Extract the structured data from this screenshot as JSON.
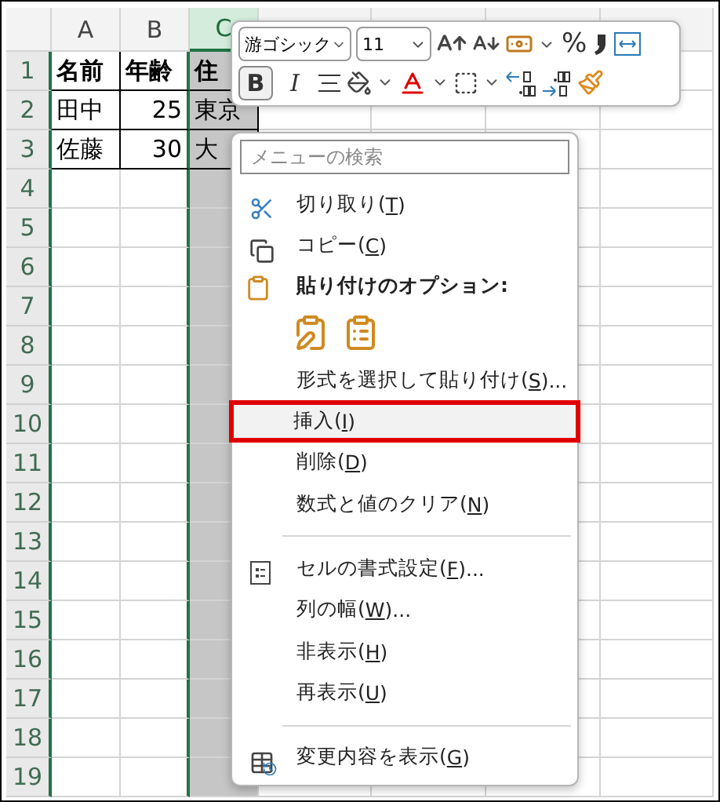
{
  "sheet": {
    "columns": [
      {
        "label": "A",
        "selected": false
      },
      {
        "label": "B",
        "selected": false
      },
      {
        "label": "C",
        "selected": true
      }
    ],
    "rows": [
      {
        "number": "1",
        "bold": true,
        "cells": [
          {
            "text": "名前",
            "numeric": false
          },
          {
            "text": "年齢",
            "numeric": false
          },
          {
            "text": "住",
            "numeric": false
          }
        ]
      },
      {
        "number": "2",
        "bold": false,
        "cells": [
          {
            "text": "田中",
            "numeric": false
          },
          {
            "text": "25",
            "numeric": true
          },
          {
            "text": "東京",
            "numeric": false
          }
        ]
      },
      {
        "number": "3",
        "bold": false,
        "cells": [
          {
            "text": "佐藤",
            "numeric": false
          },
          {
            "text": "30",
            "numeric": true
          },
          {
            "text": "大",
            "numeric": false
          }
        ]
      },
      {
        "number": "4",
        "bold": false,
        "cells": []
      },
      {
        "number": "5",
        "bold": false,
        "cells": []
      },
      {
        "number": "6",
        "bold": false,
        "cells": []
      },
      {
        "number": "7",
        "bold": false,
        "cells": []
      },
      {
        "number": "8",
        "bold": false,
        "cells": []
      },
      {
        "number": "9",
        "bold": false,
        "cells": []
      },
      {
        "number": "10",
        "bold": false,
        "cells": []
      },
      {
        "number": "11",
        "bold": false,
        "cells": []
      },
      {
        "number": "12",
        "bold": false,
        "cells": []
      },
      {
        "number": "13",
        "bold": false,
        "cells": []
      },
      {
        "number": "14",
        "bold": false,
        "cells": []
      },
      {
        "number": "15",
        "bold": false,
        "cells": []
      },
      {
        "number": "16",
        "bold": false,
        "cells": []
      },
      {
        "number": "17",
        "bold": false,
        "cells": []
      },
      {
        "number": "18",
        "bold": false,
        "cells": []
      },
      {
        "number": "19",
        "bold": false,
        "cells": []
      }
    ]
  },
  "mini_toolbar": {
    "font": "游ゴシック",
    "size": "11",
    "percent": "%",
    "bold": {
      "label": "B",
      "pressed": true
    },
    "italic": {
      "label": "I",
      "pressed": false
    }
  },
  "context_menu": {
    "search": {
      "placeholder": "メニューの検索"
    },
    "items": [
      {
        "kind": "command",
        "before": "切り取り(",
        "key": "T",
        "after": ")",
        "highlighted": false
      },
      {
        "kind": "command",
        "before": "コピー(",
        "key": "C",
        "after": ")",
        "highlighted": false
      },
      {
        "kind": "heading",
        "label": "貼り付けのオプション:"
      },
      {
        "kind": "paste-options"
      },
      {
        "kind": "command",
        "before": "形式を選択して貼り付け(",
        "key": "S",
        "after": ")...",
        "highlighted": false
      },
      {
        "kind": "command",
        "before": "挿入(",
        "key": "I",
        "after": ")",
        "highlighted": true
      },
      {
        "kind": "command",
        "before": "削除(",
        "key": "D",
        "after": ")",
        "highlighted": false
      },
      {
        "kind": "command",
        "before": "数式と値のクリア(",
        "key": "N",
        "after": ")",
        "highlighted": false
      },
      {
        "kind": "divider"
      },
      {
        "kind": "command",
        "before": "セルの書式設定(",
        "key": "F",
        "after": ")...",
        "highlighted": false
      },
      {
        "kind": "command",
        "before": "列の幅(",
        "key": "W",
        "after": ")...",
        "highlighted": false
      },
      {
        "kind": "command",
        "before": "非表示(",
        "key": "H",
        "after": ")",
        "highlighted": false
      },
      {
        "kind": "command",
        "before": "再表示(",
        "key": "U",
        "after": ")",
        "highlighted": false
      },
      {
        "kind": "divider"
      },
      {
        "kind": "command",
        "before": "変更内容を表示(",
        "key": "G",
        "after": ")",
        "highlighted": false
      }
    ]
  }
}
